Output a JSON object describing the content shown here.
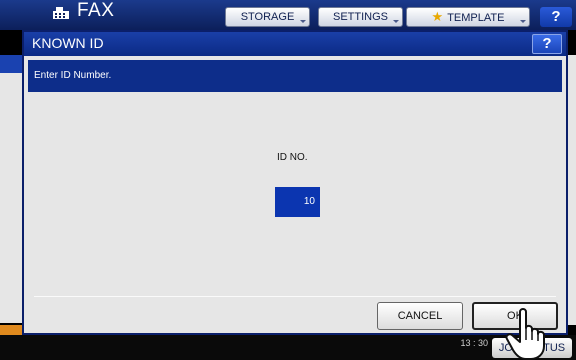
{
  "background": {
    "title": "FAX",
    "tabs": [
      {
        "label": "STORAGE"
      },
      {
        "label": "SETTINGS"
      },
      {
        "label": "TEMPLATE"
      }
    ],
    "help_label": "?",
    "time": "13 : 30",
    "jobs_button": "JOB STATUS"
  },
  "dialog": {
    "title": "KNOWN ID",
    "help_label": "?",
    "message": "Enter ID Number.",
    "id_label": "ID NO.",
    "id_value": "10",
    "cancel_label": "CANCEL",
    "ok_label": "OK"
  },
  "colors": {
    "header_blue": "#0c1f5a",
    "dialog_blue": "#0d2d8a",
    "field_blue": "#0b35b0",
    "accent_orange": "#e08a1e"
  },
  "icons": {
    "fax": "fax-icon",
    "template": "star-icon",
    "pointer": "hand-pointer-icon"
  }
}
